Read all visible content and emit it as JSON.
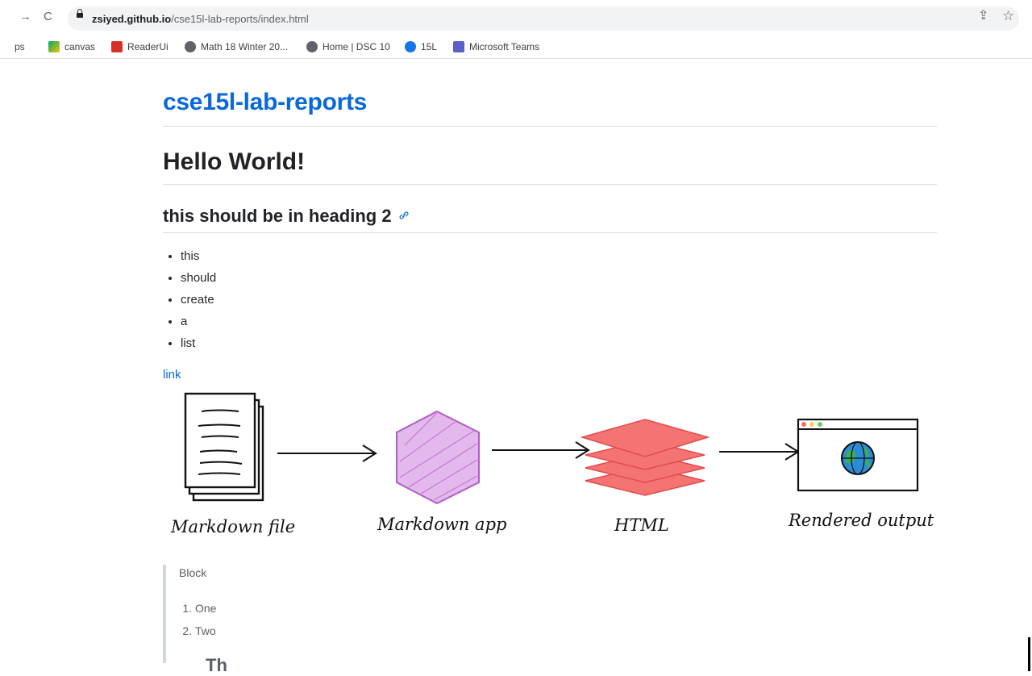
{
  "browser": {
    "url_host": "zsiyed.github.io",
    "url_path": "/cse15l-lab-reports/index.html",
    "bookmarks": [
      {
        "label": "ps"
      },
      {
        "label": "canvas"
      },
      {
        "label": "ReaderUi"
      },
      {
        "label": "Math 18 Winter 20..."
      },
      {
        "label": "Home | DSC 10"
      },
      {
        "label": "15L"
      },
      {
        "label": "Microsoft Teams"
      }
    ]
  },
  "page": {
    "site_title": "cse15l-lab-reports",
    "heading1": "Hello World!",
    "heading2": "this should be in heading 2",
    "anchor_glyph": "🔗",
    "list_items": [
      "this",
      "should",
      "create",
      "a",
      "list"
    ],
    "link_text": "link",
    "diagram_labels": {
      "markdown_file": "Markdown file",
      "markdown_app": "Markdown app",
      "html": "HTML",
      "rendered_output": "Rendered output"
    },
    "blockquote": {
      "text": "Block",
      "items": [
        "One",
        "Two"
      ],
      "cut_heading": "Th"
    }
  },
  "colors": {
    "link": "#0969da",
    "html_layers": "#f47474",
    "app_hexagon": "#c77bd6"
  }
}
